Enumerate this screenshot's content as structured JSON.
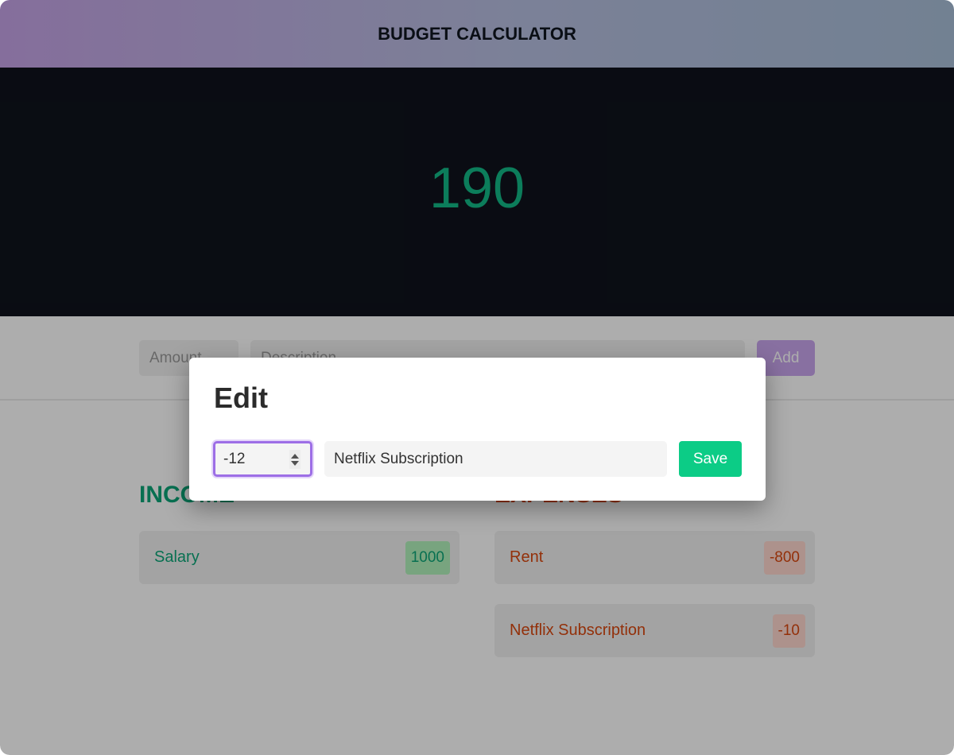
{
  "header": {
    "title": "BUDGET CALCULATOR"
  },
  "balance": {
    "value": "190"
  },
  "add_form": {
    "amount_placeholder": "Amount",
    "description_placeholder": "Description",
    "add_label": "Add"
  },
  "income": {
    "heading": "INCOME",
    "items": [
      {
        "label": "Salary",
        "value": "1000"
      }
    ]
  },
  "expenses": {
    "heading": "EXPENSES",
    "items": [
      {
        "label": "Rent",
        "value": "-800"
      },
      {
        "label": "Netflix Subscription",
        "value": "-10"
      }
    ]
  },
  "edit_modal": {
    "title": "Edit",
    "amount_value": "-12",
    "description_value": "Netflix Subscription",
    "save_label": "Save"
  },
  "colors": {
    "income": "#0ca678",
    "expense": "#d9480f",
    "accent": "#9d6ee6",
    "save": "#0ccc86",
    "balance": "#12b886"
  }
}
